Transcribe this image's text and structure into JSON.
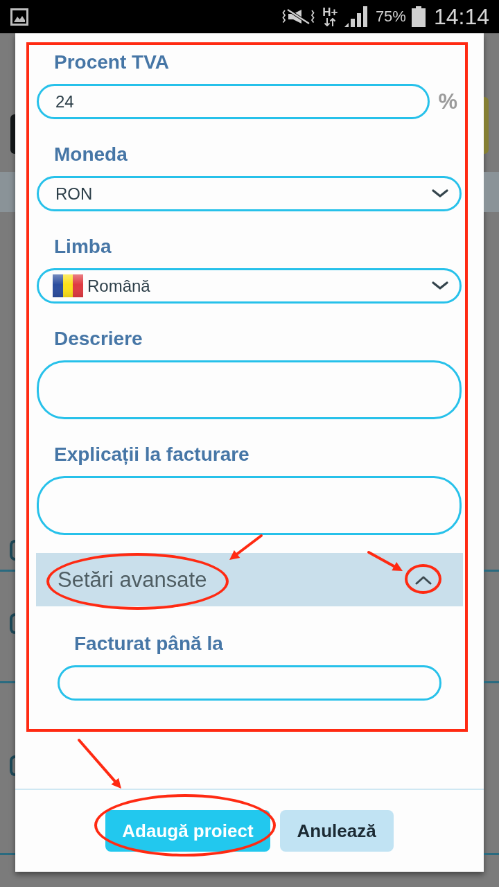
{
  "status_bar": {
    "network": "H+",
    "battery": "75%",
    "time": "14:14"
  },
  "dialog": {
    "fields": [
      {
        "kind": "input",
        "label": "Procent TVA",
        "value": "24",
        "unit": "%"
      },
      {
        "kind": "select",
        "label": "Moneda",
        "value": "RON"
      },
      {
        "kind": "language-select",
        "label": "Limba",
        "value": "Română"
      },
      {
        "kind": "textarea",
        "label": "Descriere"
      },
      {
        "kind": "textarea",
        "label": "Explicații la facturare"
      }
    ],
    "advanced": {
      "title": "Setări avansate",
      "expanded": true,
      "fields": [
        {
          "kind": "input",
          "label": "Facturat până la"
        }
      ]
    },
    "buttons": [
      {
        "kind": "primary",
        "label": "Adaugă proiect"
      },
      {
        "kind": "secondary",
        "label": "Anulează"
      }
    ]
  }
}
